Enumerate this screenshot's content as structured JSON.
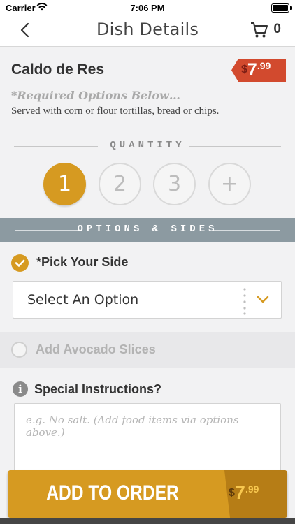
{
  "status_bar": {
    "carrier": "Carrier",
    "time": "7:06 PM"
  },
  "nav": {
    "title": "Dish Details",
    "cart_count": "0",
    "icons": [
      "back-chevron-icon",
      "cart-icon"
    ]
  },
  "dish": {
    "name": "Caldo de Res",
    "price": {
      "currency": "$",
      "amount": "7",
      "cents": ".99"
    },
    "required_note": "*Required Options Below…",
    "description": "Served with corn or flour tortillas, bread or chips."
  },
  "quantity": {
    "label": "QUANTITY",
    "options": [
      "1",
      "2",
      "3",
      "+"
    ],
    "selected": "1"
  },
  "options_header": "OPTIONS & SIDES",
  "pick_side": {
    "label": "*Pick Your Side",
    "select_value": "Select An Option",
    "checked": true
  },
  "avocado": {
    "label": "Add Avocado Slices",
    "checked": false
  },
  "special": {
    "label": "Special Instructions?",
    "placeholder": "e.g. No salt. (Add food items via options above.)"
  },
  "add_button": {
    "label": "ADD TO ORDER",
    "currency": "$",
    "amount": "7",
    "cents": ".99"
  },
  "colors": {
    "accent": "#d69a21",
    "price_tag": "#d24a2e",
    "options_header": "#8c9aa1"
  }
}
